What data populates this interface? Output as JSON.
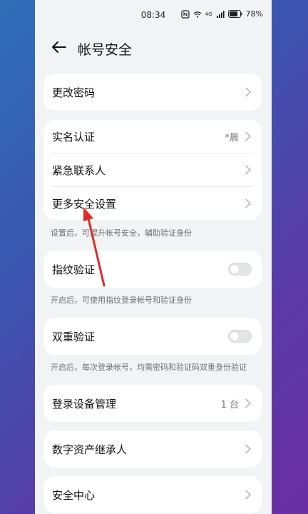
{
  "status": {
    "time": "08:34",
    "battery": "78%",
    "network": "4G"
  },
  "header": {
    "title": "帐号安全"
  },
  "card_password": {
    "label": "更改密码"
  },
  "card_security": {
    "items": [
      {
        "label": "实名认证",
        "value": "*晨"
      },
      {
        "label": "紧急联系人",
        "value": ""
      },
      {
        "label": "更多安全设置",
        "value": ""
      }
    ],
    "note": "设置后，可提升帐号安全，辅助验证身份"
  },
  "fingerprint": {
    "label": "指纹验证",
    "note": "开启后，可使用指纹登录帐号和验证身份",
    "enabled": false
  },
  "two_factor": {
    "label": "双重验证",
    "note": "开启后，每次登录帐号，均需密码和验证码双重身份验证",
    "enabled": false
  },
  "devices": {
    "label": "登录设备管理",
    "value": "1 台"
  },
  "heir": {
    "label": "数字资产继承人"
  },
  "security_center": {
    "label": "安全中心"
  },
  "colors": {
    "annotation_arrow": "#e02b2b",
    "toggle_off": "#e3e4e6"
  }
}
